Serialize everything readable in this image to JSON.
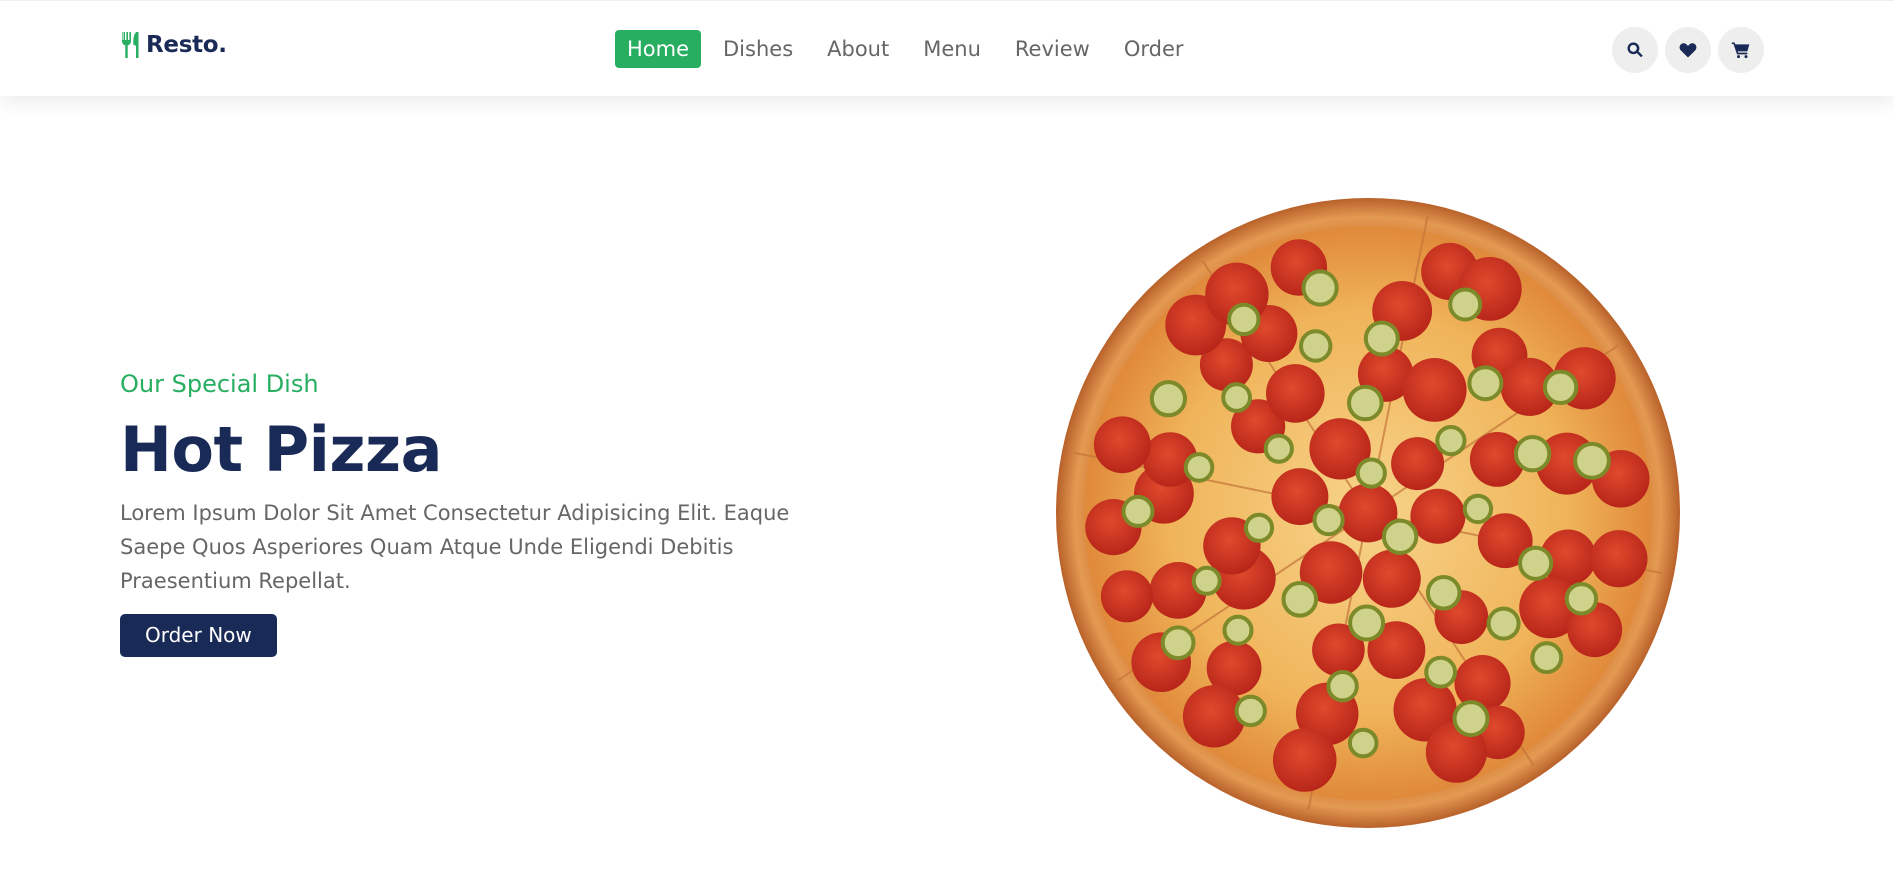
{
  "header": {
    "logo_text": "Resto.",
    "nav": [
      {
        "label": "Home",
        "active": true
      },
      {
        "label": "Dishes",
        "active": false
      },
      {
        "label": "About",
        "active": false
      },
      {
        "label": "Menu",
        "active": false
      },
      {
        "label": "Review",
        "active": false
      },
      {
        "label": "Order",
        "active": false
      }
    ],
    "icons": [
      "search-icon",
      "heart-icon",
      "cart-icon"
    ]
  },
  "hero": {
    "subtitle": "Our Special Dish",
    "title": "Hot Pizza",
    "description": "Lorem Ipsum Dolor Sit Amet Consectetur Adipisicing Elit. Eaque Saepe Quos Asperiores Quam Atque Unde Eligendi Debitis Praesentium Repellat.",
    "button_label": "Order Now",
    "image": "pepperoni-jalapeno-pizza"
  },
  "colors": {
    "accent": "#27ae60",
    "primary": "#192a56",
    "text_muted": "#666666",
    "icon_bg": "#eeeeee"
  }
}
